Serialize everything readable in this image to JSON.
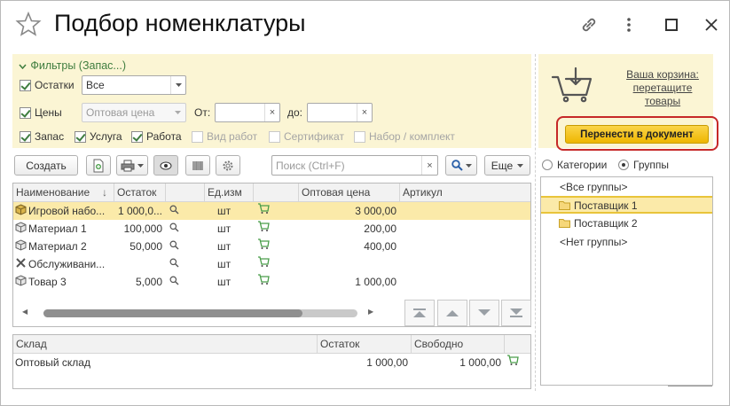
{
  "window": {
    "title": "Подбор номенклатуры"
  },
  "filters": {
    "header": "Фильтры (Запас...)",
    "ostatki_label": "Остатки",
    "ostatki_value": "Все",
    "ceny_label": "Цены",
    "price_type_placeholder": "Оптовая цена",
    "from_label": "От:",
    "to_label": "до:",
    "types": [
      {
        "label": "Запас",
        "checked": true
      },
      {
        "label": "Услуга",
        "checked": true
      },
      {
        "label": "Работа",
        "checked": true
      },
      {
        "label": "Вид работ",
        "checked": false
      },
      {
        "label": "Сертификат",
        "checked": false
      },
      {
        "label": "Набор / комплект",
        "checked": false
      }
    ]
  },
  "cart": {
    "hint": "Ваша корзина: перетащите товары",
    "transfer_button": "Перенести в документ"
  },
  "toolbar": {
    "create_label": "Создать",
    "search_placeholder": "Поиск (Ctrl+F)",
    "more_label": "Еще"
  },
  "view_mode": {
    "categories_label": "Категории",
    "groups_label": "Группы",
    "selected": "Группы"
  },
  "products": {
    "columns": [
      "Наименование",
      "Остаток",
      "",
      "Ед.изм",
      "",
      "Оптовая цена",
      "Артикул"
    ],
    "rows": [
      {
        "name": "Игровой набо...",
        "stock": "1 000,0...",
        "unit": "шт",
        "price": "3 000,00",
        "article": "",
        "icon": "kit-icon",
        "selected": true
      },
      {
        "name": "Материал 1",
        "stock": "100,000",
        "unit": "шт",
        "price": "200,00",
        "article": "",
        "icon": "box-icon",
        "selected": false
      },
      {
        "name": "Материал 2",
        "stock": "50,000",
        "unit": "шт",
        "price": "400,00",
        "article": "",
        "icon": "box-icon",
        "selected": false
      },
      {
        "name": "Обслуживани...",
        "stock": "",
        "unit": "шт",
        "price": "",
        "article": "",
        "icon": "tools-icon",
        "selected": false
      },
      {
        "name": "Товар 3",
        "stock": "5,000",
        "unit": "шт",
        "price": "1 000,00",
        "article": "",
        "icon": "box-icon",
        "selected": false
      }
    ]
  },
  "warehouses": {
    "columns": [
      "Склад",
      "Остаток",
      "Свободно"
    ],
    "rows": [
      {
        "name": "Оптовый склад",
        "stock": "1 000,00",
        "free": "1 000,00"
      }
    ]
  },
  "groups": {
    "items": [
      {
        "label": "<Все группы>",
        "folder": false,
        "selected": false
      },
      {
        "label": "Поставщик 1",
        "folder": true,
        "selected": true
      },
      {
        "label": "Поставщик 2",
        "folder": true,
        "selected": false
      },
      {
        "label": "<Нет группы>",
        "folder": false,
        "selected": false
      }
    ]
  },
  "colors": {
    "accent_green": "#3f7d3f",
    "filter_bg": "#fbf5d4",
    "selected_row": "#fbeaa9",
    "transfer_button": "#f5c518",
    "highlight_border": "#c62828"
  }
}
